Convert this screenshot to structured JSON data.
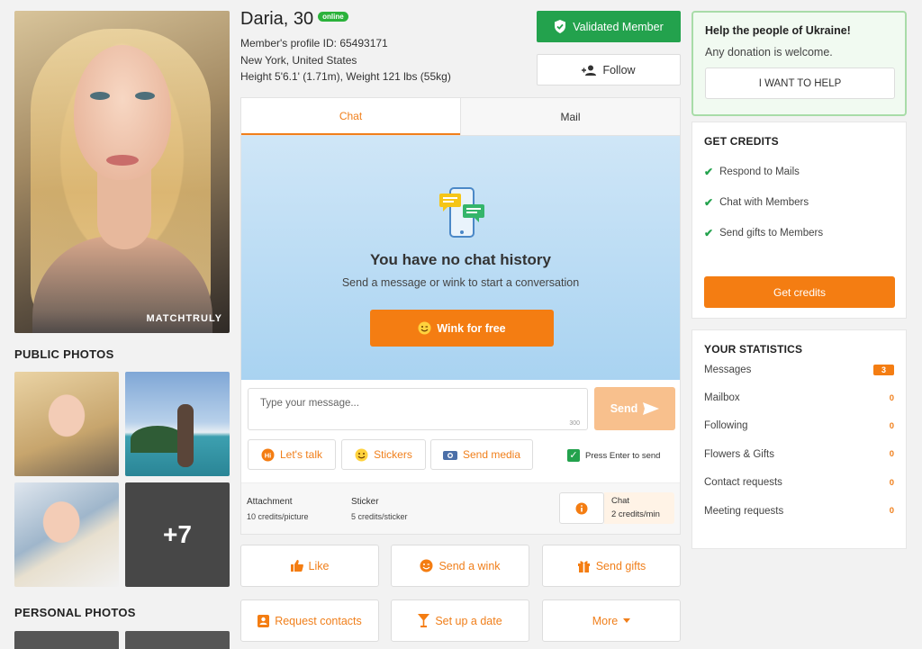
{
  "profile": {
    "name": "Daria, 30",
    "online_badge": "online",
    "member_id": "Member's profile ID: 65493171",
    "location": "New York, United States",
    "physique": "Height 5'6.1' (1.71m), Weight 121 lbs (55kg)",
    "watermark": "MATCHTRULY"
  },
  "header_buttons": {
    "validated": "Validated Member",
    "follow": "Follow"
  },
  "left": {
    "public_photos_title": "PUBLIC PHOTOS",
    "more_photos": "+7",
    "personal_photos_title": "PERSONAL PHOTOS"
  },
  "tabs": {
    "chat": "Chat",
    "mail": "Mail"
  },
  "chat": {
    "no_history": "You have no chat history",
    "no_history_sub": "Send a message or wink to start a conversation",
    "wink_free": "Wink for free",
    "input_placeholder": "Type your message...",
    "char_counter": "300",
    "send": "Send",
    "lets_talk": "Let's talk",
    "stickers": "Stickers",
    "send_media": "Send media",
    "press_enter": "Press Enter to send"
  },
  "pricing": {
    "attachment_label": "Attachment",
    "attachment_price": "10 credits/picture",
    "sticker_label": "Sticker",
    "sticker_price": "5 credits/sticker",
    "chat_label": "Chat",
    "chat_price": "2 credits/min"
  },
  "actions": {
    "like": "Like",
    "send_wink": "Send a wink",
    "send_gifts": "Send gifts",
    "request_contacts": "Request contacts",
    "set_up_date": "Set up a date",
    "more": "More"
  },
  "ukraine": {
    "title": "Help the people of Ukraine!",
    "subtitle": "Any donation is welcome.",
    "button": "I WANT TO HELP"
  },
  "credits": {
    "title": "GET CREDITS",
    "items": [
      "Respond to Mails",
      "Chat with Members",
      "Send gifts to Members"
    ],
    "button": "Get credits"
  },
  "stats": {
    "title": "YOUR STATISTICS",
    "rows": [
      {
        "label": "Messages",
        "value": "3"
      },
      {
        "label": "Mailbox",
        "value": "0"
      },
      {
        "label": "Following",
        "value": "0"
      },
      {
        "label": "Flowers & Gifts",
        "value": "0"
      },
      {
        "label": "Contact requests",
        "value": "0"
      },
      {
        "label": "Meeting requests",
        "value": "0"
      }
    ]
  },
  "colors": {
    "accent_orange": "#f47d12",
    "validated_green": "#23a24d",
    "online_green": "#2bb23b"
  }
}
